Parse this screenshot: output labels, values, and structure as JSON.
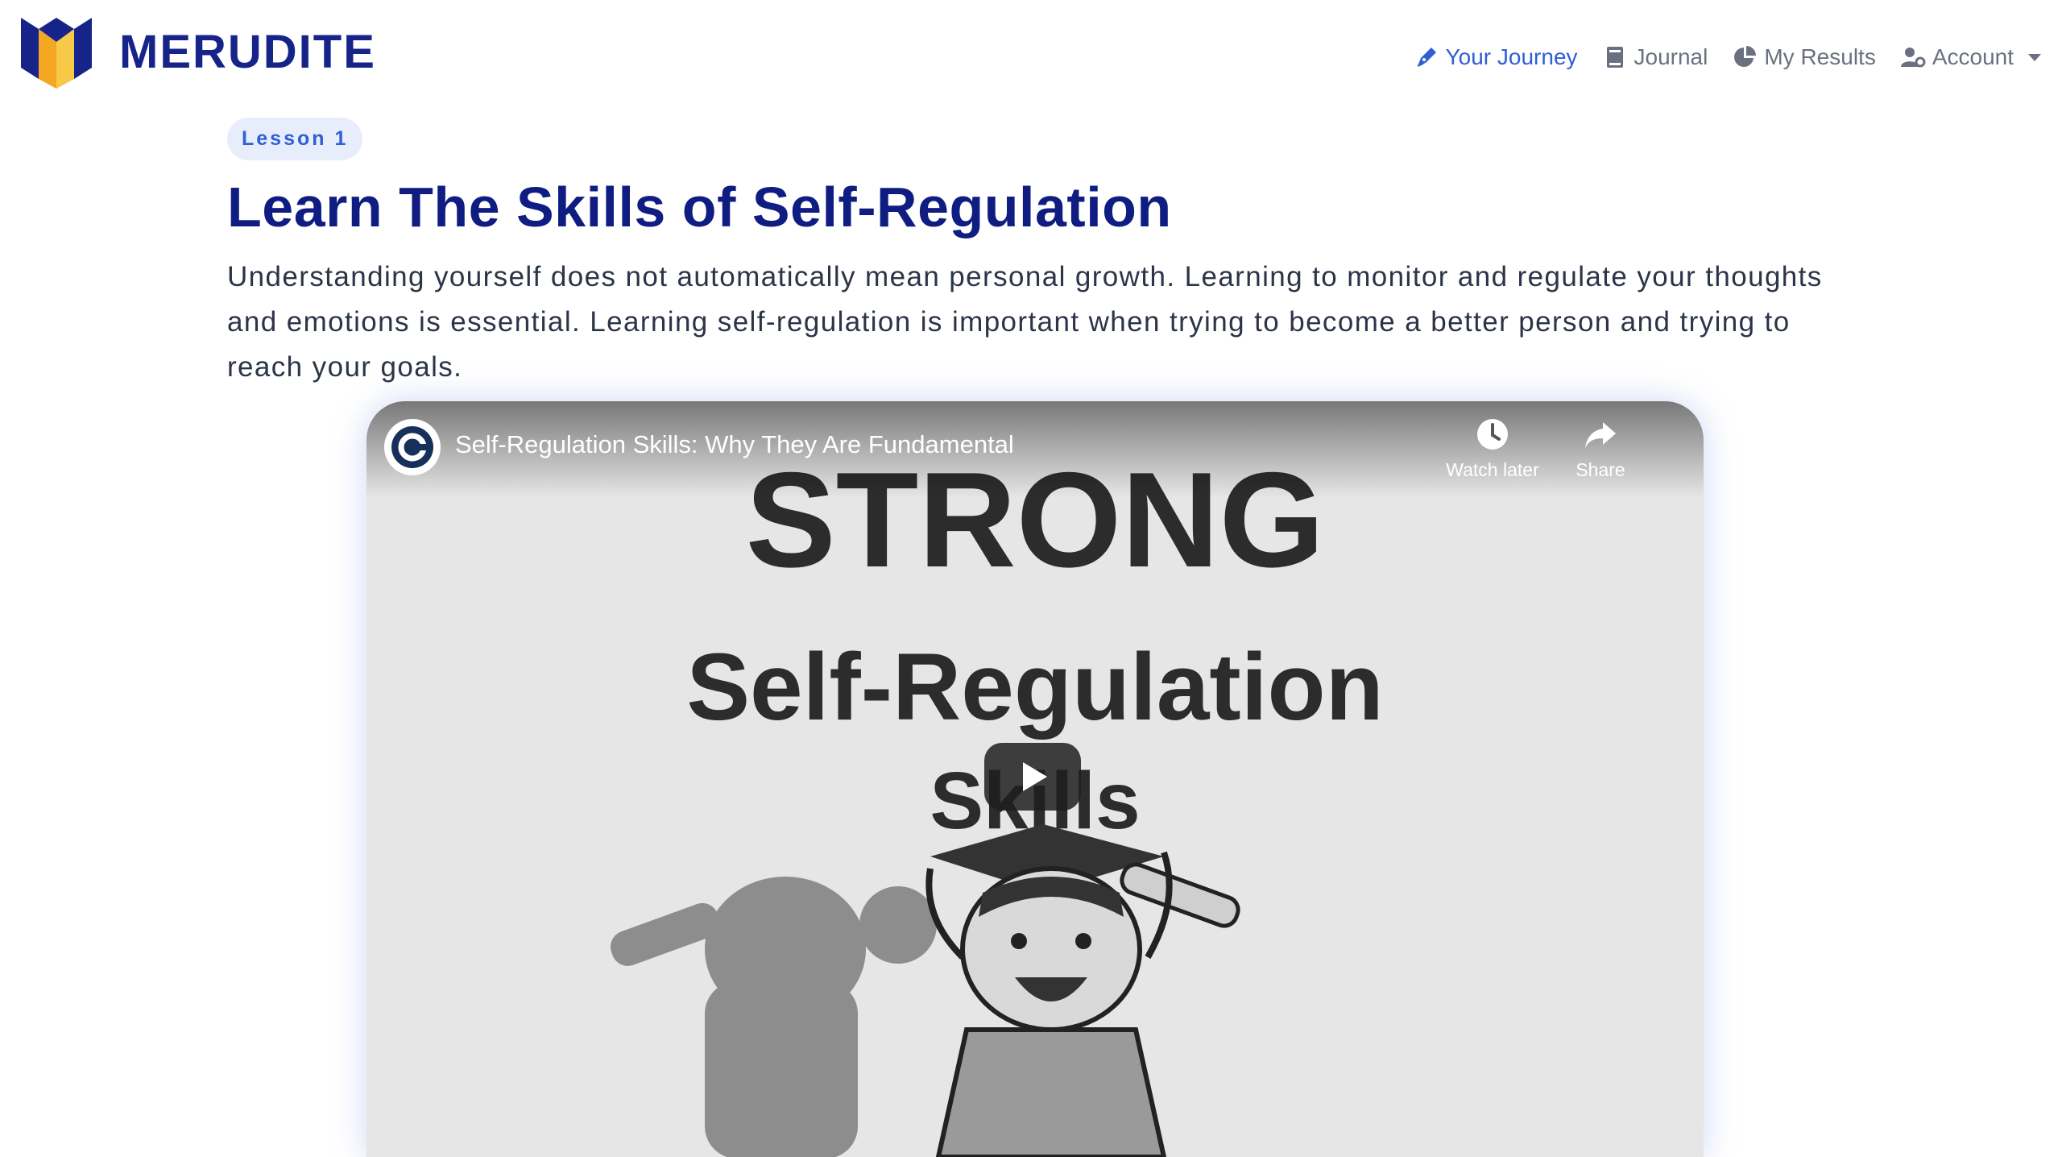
{
  "brand": {
    "name": "MERUDITE",
    "colors": {
      "navy": "#16248a",
      "orange": "#f5a623",
      "yellow": "#f7c948",
      "blue": "#2f5fd6"
    }
  },
  "nav": {
    "items": [
      {
        "label": "Your Journey",
        "icon": "pen-icon",
        "active": true
      },
      {
        "label": "Journal",
        "icon": "book-icon",
        "active": false
      },
      {
        "label": "My Results",
        "icon": "pie-chart-icon",
        "active": false
      },
      {
        "label": "Account",
        "icon": "user-gear-icon",
        "active": false,
        "dropdown": true
      }
    ]
  },
  "lesson": {
    "badge": "Lesson 1",
    "title": "Learn The Skills of Self-Regulation",
    "description": "Understanding yourself does not automatically mean personal growth. Learning to monitor and regulate your thoughts and emotions is essential. Learning self-regulation is important when trying to become a better person and trying to reach your goals."
  },
  "video": {
    "title": "Self-Regulation Skills: Why They Are Fundamental",
    "watch_later": "Watch later",
    "share": "Share",
    "thumbnail": {
      "line1": "STRONG",
      "line2": "Self-Regulation",
      "line3": "Skills"
    }
  }
}
